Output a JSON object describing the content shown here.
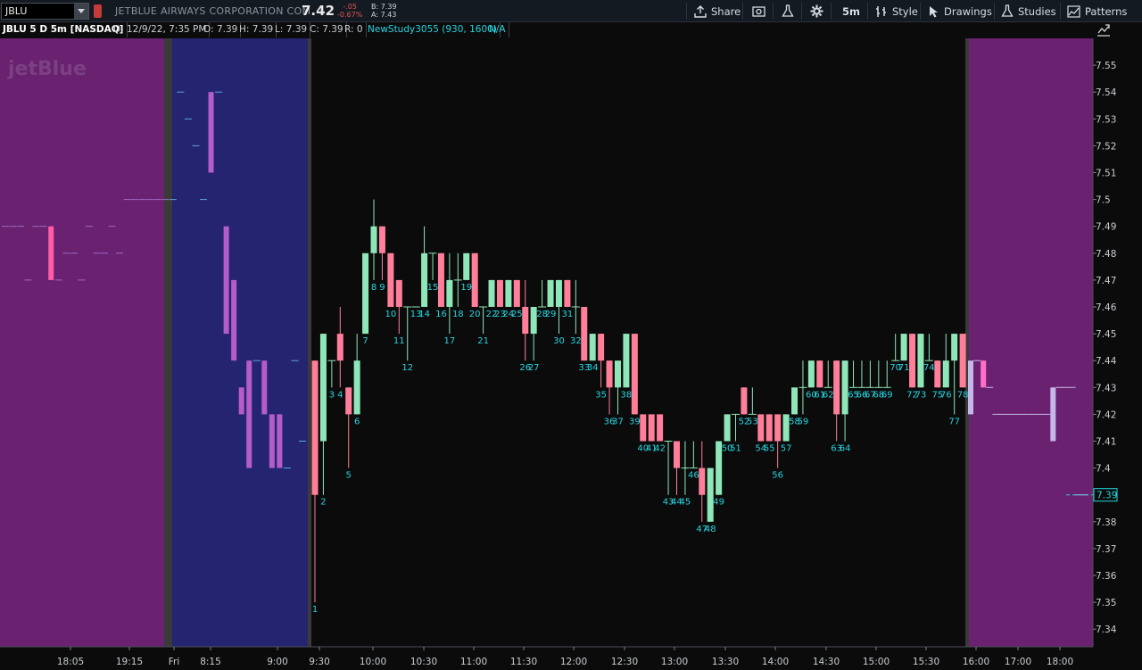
{
  "toolbar": {
    "symbol": "JBLU",
    "company": "JETBLUE AIRWAYS CORPORATION COM",
    "last": "7.42",
    "change": "-.05",
    "change_pct": "-0.67%",
    "bid": "B: 7.39",
    "ask": "A: 7.43",
    "share_label": "Share",
    "interval_label": "5m",
    "style_label": "Style",
    "drawings_label": "Drawings",
    "studies_label": "Studies",
    "patterns_label": "Patterns"
  },
  "infobar": {
    "symbol": "JBLU 5 D 5m [NASDAQ]",
    "date": "D: 12/9/22, 7:35 PM",
    "open": "O: 7.39",
    "high": "H: 7.39",
    "low": "L: 7.39",
    "close": "C: 7.39",
    "range": "R: 0",
    "study": "NewStudy3055 (930, 1600)",
    "study_value": "N/A"
  },
  "watermark": "jetBlue",
  "colors": {
    "up": "#8fe6b8",
    "down": "#ff7f9a",
    "ext_up": "#5aa8d6",
    "ext_down": "#c05cd0",
    "pre_bg": "#252470",
    "after_bg": "#6a2170",
    "session_bg": "#0b0b0b",
    "divider": "#3a3a3a",
    "label": "#25d4e0"
  },
  "chart_data": {
    "type": "candlestick",
    "title": "JBLU 5 D 5m [NASDAQ]",
    "ylim": [
      7.335,
      7.56
    ],
    "y_ticks": [
      "7.55",
      "7.54",
      "7.53",
      "7.52",
      "7.51",
      "7.5",
      "7.49",
      "7.48",
      "7.47",
      "7.46",
      "7.45",
      "7.44",
      "7.43",
      "7.42",
      "7.41",
      "7.4",
      "7.39",
      "7.38",
      "7.37",
      "7.36",
      "7.35",
      "7.34"
    ],
    "x_ticks": [
      "18:05",
      "19:15",
      "Fri",
      "8:15",
      "9:00",
      "9:30",
      "10:00",
      "10:30",
      "11:00",
      "11:30",
      "12:00",
      "12:30",
      "13:00",
      "13:30",
      "14:00",
      "14:30",
      "15:00",
      "15:30",
      "16:00",
      "17:00",
      "18:00"
    ],
    "last_price_label": "7.39",
    "extended_before": [
      {
        "o": 7.49,
        "h": 7.49,
        "l": 7.49,
        "c": 7.49
      },
      {
        "o": 7.49,
        "h": 7.49,
        "l": 7.49,
        "c": 7.49
      },
      {
        "o": 7.49,
        "h": 7.49,
        "l": 7.49,
        "c": 7.49
      },
      {
        "o": 7.47,
        "h": 7.47,
        "l": 7.47,
        "c": 7.47
      },
      {
        "o": 7.49,
        "h": 7.49,
        "l": 7.49,
        "c": 7.49
      },
      {
        "o": 7.49,
        "h": 7.49,
        "l": 7.49,
        "c": 7.49
      },
      {
        "o": 7.49,
        "h": 7.49,
        "l": 7.47,
        "c": 7.47
      },
      {
        "o": 7.47,
        "h": 7.47,
        "l": 7.47,
        "c": 7.47
      },
      {
        "o": 7.48,
        "h": 7.48,
        "l": 7.48,
        "c": 7.48
      },
      {
        "o": 7.48,
        "h": 7.48,
        "l": 7.48,
        "c": 7.48
      },
      {
        "o": 7.47,
        "h": 7.47,
        "l": 7.47,
        "c": 7.47
      },
      {
        "o": 7.49,
        "h": 7.49,
        "l": 7.49,
        "c": 7.49
      },
      {
        "o": 7.48,
        "h": 7.48,
        "l": 7.48,
        "c": 7.48
      },
      {
        "o": 7.48,
        "h": 7.48,
        "l": 7.48,
        "c": 7.48
      },
      {
        "o": 7.49,
        "h": 7.49,
        "l": 7.49,
        "c": 7.49
      },
      {
        "o": 7.48,
        "h": 7.48,
        "l": 7.48,
        "c": 7.48
      },
      {
        "o": 7.5,
        "h": 7.5,
        "l": 7.5,
        "c": 7.5
      },
      {
        "o": 7.5,
        "h": 7.5,
        "l": 7.5,
        "c": 7.5
      },
      {
        "o": 7.5,
        "h": 7.5,
        "l": 7.5,
        "c": 7.5
      },
      {
        "o": 7.5,
        "h": 7.5,
        "l": 7.5,
        "c": 7.5
      },
      {
        "o": 7.5,
        "h": 7.5,
        "l": 7.5,
        "c": 7.5
      },
      {
        "o": 7.5,
        "h": 7.5,
        "l": 7.5,
        "c": 7.5
      },
      {
        "o": 7.5,
        "h": 7.5,
        "l": 7.5,
        "c": 7.5
      },
      {
        "o": 7.54,
        "h": 7.54,
        "l": 7.54,
        "c": 7.54
      },
      {
        "o": 7.53,
        "h": 7.53,
        "l": 7.53,
        "c": 7.53
      },
      {
        "o": 7.52,
        "h": 7.52,
        "l": 7.52,
        "c": 7.52
      },
      {
        "o": 7.5,
        "h": 7.5,
        "l": 7.5,
        "c": 7.5
      },
      {
        "o": 7.54,
        "h": 7.54,
        "l": 7.51,
        "c": 7.51
      },
      {
        "o": 7.54,
        "h": 7.54,
        "l": 7.54,
        "c": 7.54
      },
      {
        "o": 7.49,
        "h": 7.49,
        "l": 7.45,
        "c": 7.45
      },
      {
        "o": 7.47,
        "h": 7.47,
        "l": 7.44,
        "c": 7.44
      },
      {
        "o": 7.43,
        "h": 7.43,
        "l": 7.42,
        "c": 7.42
      },
      {
        "o": 7.44,
        "h": 7.44,
        "l": 7.4,
        "c": 7.4
      },
      {
        "o": 7.44,
        "h": 7.44,
        "l": 7.44,
        "c": 7.44
      },
      {
        "o": 7.44,
        "h": 7.44,
        "l": 7.42,
        "c": 7.42
      },
      {
        "o": 7.42,
        "h": 7.42,
        "l": 7.4,
        "c": 7.4
      },
      {
        "o": 7.42,
        "h": 7.42,
        "l": 7.4,
        "c": 7.4
      },
      {
        "o": 7.4,
        "h": 7.4,
        "l": 7.4,
        "c": 7.4
      },
      {
        "o": 7.44,
        "h": 7.44,
        "l": 7.44,
        "c": 7.44
      },
      {
        "o": 7.41,
        "h": 7.41,
        "l": 7.41,
        "c": 7.41
      }
    ],
    "session": [
      {
        "label": "1",
        "o": 7.44,
        "h": 7.44,
        "l": 7.35,
        "c": 7.39
      },
      {
        "label": "2",
        "o": 7.41,
        "h": 7.45,
        "l": 7.39,
        "c": 7.45
      },
      {
        "label": "3",
        "o": 7.44,
        "h": 7.44,
        "l": 7.43,
        "c": 7.44
      },
      {
        "label": "4",
        "o": 7.45,
        "h": 7.46,
        "l": 7.43,
        "c": 7.44
      },
      {
        "label": "5",
        "o": 7.43,
        "h": 7.43,
        "l": 7.4,
        "c": 7.42
      },
      {
        "label": "6",
        "o": 7.42,
        "h": 7.45,
        "l": 7.42,
        "c": 7.44
      },
      {
        "label": "7",
        "o": 7.45,
        "h": 7.48,
        "l": 7.45,
        "c": 7.48
      },
      {
        "label": "8",
        "o": 7.48,
        "h": 7.5,
        "l": 7.47,
        "c": 7.49
      },
      {
        "label": "9",
        "o": 7.49,
        "h": 7.49,
        "l": 7.47,
        "c": 7.48
      },
      {
        "label": "10",
        "o": 7.48,
        "h": 7.48,
        "l": 7.46,
        "c": 7.46
      },
      {
        "label": "11",
        "o": 7.47,
        "h": 7.47,
        "l": 7.45,
        "c": 7.46
      },
      {
        "label": "12",
        "o": 7.46,
        "h": 7.46,
        "l": 7.44,
        "c": 7.46
      },
      {
        "label": "13",
        "o": 7.46,
        "h": 7.46,
        "l": 7.46,
        "c": 7.46
      },
      {
        "label": "14",
        "o": 7.46,
        "h": 7.49,
        "l": 7.46,
        "c": 7.48
      },
      {
        "label": "15",
        "o": 7.48,
        "h": 7.48,
        "l": 7.47,
        "c": 7.48
      },
      {
        "label": "16",
        "o": 7.48,
        "h": 7.48,
        "l": 7.46,
        "c": 7.46
      },
      {
        "label": "17",
        "o": 7.46,
        "h": 7.48,
        "l": 7.45,
        "c": 7.47
      },
      {
        "label": "18",
        "o": 7.47,
        "h": 7.48,
        "l": 7.46,
        "c": 7.47
      },
      {
        "label": "19",
        "o": 7.47,
        "h": 7.48,
        "l": 7.47,
        "c": 7.48
      },
      {
        "label": "20",
        "o": 7.48,
        "h": 7.48,
        "l": 7.46,
        "c": 7.46
      },
      {
        "label": "21",
        "o": 7.46,
        "h": 7.46,
        "l": 7.45,
        "c": 7.46
      },
      {
        "label": "22",
        "o": 7.46,
        "h": 7.47,
        "l": 7.46,
        "c": 7.47
      },
      {
        "label": "23",
        "o": 7.47,
        "h": 7.47,
        "l": 7.46,
        "c": 7.46
      },
      {
        "label": "24",
        "o": 7.46,
        "h": 7.47,
        "l": 7.46,
        "c": 7.47
      },
      {
        "label": "25",
        "o": 7.47,
        "h": 7.47,
        "l": 7.46,
        "c": 7.46
      },
      {
        "label": "26",
        "o": 7.46,
        "h": 7.47,
        "l": 7.44,
        "c": 7.45
      },
      {
        "label": "27",
        "o": 7.45,
        "h": 7.46,
        "l": 7.44,
        "c": 7.46
      },
      {
        "label": "28",
        "o": 7.46,
        "h": 7.47,
        "l": 7.46,
        "c": 7.46
      },
      {
        "label": "29",
        "o": 7.46,
        "h": 7.47,
        "l": 7.46,
        "c": 7.47
      },
      {
        "label": "30",
        "o": 7.46,
        "h": 7.47,
        "l": 7.45,
        "c": 7.47
      },
      {
        "label": "31",
        "o": 7.47,
        "h": 7.47,
        "l": 7.46,
        "c": 7.46
      },
      {
        "label": "32",
        "o": 7.46,
        "h": 7.47,
        "l": 7.45,
        "c": 7.46
      },
      {
        "label": "33",
        "o": 7.46,
        "h": 7.46,
        "l": 7.44,
        "c": 7.44
      },
      {
        "label": "34",
        "o": 7.44,
        "h": 7.45,
        "l": 7.44,
        "c": 7.45
      },
      {
        "label": "35",
        "o": 7.45,
        "h": 7.45,
        "l": 7.43,
        "c": 7.44
      },
      {
        "label": "36",
        "o": 7.44,
        "h": 7.44,
        "l": 7.42,
        "c": 7.43
      },
      {
        "label": "37",
        "o": 7.43,
        "h": 7.44,
        "l": 7.42,
        "c": 7.44
      },
      {
        "label": "38",
        "o": 7.43,
        "h": 7.45,
        "l": 7.43,
        "c": 7.45
      },
      {
        "label": "39",
        "o": 7.45,
        "h": 7.45,
        "l": 7.42,
        "c": 7.42
      },
      {
        "label": "40",
        "o": 7.42,
        "h": 7.42,
        "l": 7.41,
        "c": 7.41
      },
      {
        "label": "41",
        "o": 7.42,
        "h": 7.42,
        "l": 7.41,
        "c": 7.41
      },
      {
        "label": "42",
        "o": 7.42,
        "h": 7.42,
        "l": 7.41,
        "c": 7.41
      },
      {
        "label": "43",
        "o": 7.41,
        "h": 7.41,
        "l": 7.39,
        "c": 7.41
      },
      {
        "label": "44",
        "o": 7.41,
        "h": 7.41,
        "l": 7.39,
        "c": 7.4
      },
      {
        "label": "45",
        "o": 7.4,
        "h": 7.41,
        "l": 7.39,
        "c": 7.4
      },
      {
        "label": "46",
        "o": 7.4,
        "h": 7.41,
        "l": 7.4,
        "c": 7.4
      },
      {
        "label": "47",
        "o": 7.4,
        "h": 7.41,
        "l": 7.38,
        "c": 7.39
      },
      {
        "label": "48",
        "o": 7.38,
        "h": 7.4,
        "l": 7.38,
        "c": 7.4
      },
      {
        "label": "49",
        "o": 7.39,
        "h": 7.41,
        "l": 7.39,
        "c": 7.41
      },
      {
        "label": "50",
        "o": 7.41,
        "h": 7.42,
        "l": 7.41,
        "c": 7.42
      },
      {
        "label": "51",
        "o": 7.42,
        "h": 7.42,
        "l": 7.41,
        "c": 7.42
      },
      {
        "label": "52",
        "o": 7.43,
        "h": 7.43,
        "l": 7.42,
        "c": 7.42
      },
      {
        "label": "53",
        "o": 7.42,
        "h": 7.43,
        "l": 7.42,
        "c": 7.42
      },
      {
        "label": "54",
        "o": 7.42,
        "h": 7.42,
        "l": 7.41,
        "c": 7.41
      },
      {
        "label": "55",
        "o": 7.42,
        "h": 7.42,
        "l": 7.41,
        "c": 7.41
      },
      {
        "label": "56",
        "o": 7.42,
        "h": 7.42,
        "l": 7.4,
        "c": 7.41
      },
      {
        "label": "57",
        "o": 7.41,
        "h": 7.42,
        "l": 7.41,
        "c": 7.42
      },
      {
        "label": "58",
        "o": 7.42,
        "h": 7.43,
        "l": 7.42,
        "c": 7.43
      },
      {
        "label": "59",
        "o": 7.43,
        "h": 7.44,
        "l": 7.42,
        "c": 7.43
      },
      {
        "label": "60",
        "o": 7.43,
        "h": 7.44,
        "l": 7.43,
        "c": 7.44
      },
      {
        "label": "61",
        "o": 7.44,
        "h": 7.44,
        "l": 7.43,
        "c": 7.43
      },
      {
        "label": "62",
        "o": 7.43,
        "h": 7.44,
        "l": 7.43,
        "c": 7.43
      },
      {
        "label": "63",
        "o": 7.44,
        "h": 7.44,
        "l": 7.41,
        "c": 7.42
      },
      {
        "label": "64",
        "o": 7.42,
        "h": 7.44,
        "l": 7.41,
        "c": 7.44
      },
      {
        "label": "65",
        "o": 7.43,
        "h": 7.44,
        "l": 7.43,
        "c": 7.43
      },
      {
        "label": "66",
        "o": 7.43,
        "h": 7.44,
        "l": 7.43,
        "c": 7.43
      },
      {
        "label": "67",
        "o": 7.43,
        "h": 7.44,
        "l": 7.43,
        "c": 7.43
      },
      {
        "label": "68",
        "o": 7.43,
        "h": 7.44,
        "l": 7.43,
        "c": 7.43
      },
      {
        "label": "69",
        "o": 7.43,
        "h": 7.44,
        "l": 7.43,
        "c": 7.43
      },
      {
        "label": "70",
        "o": 7.44,
        "h": 7.45,
        "l": 7.44,
        "c": 7.44
      },
      {
        "label": "71",
        "o": 7.44,
        "h": 7.45,
        "l": 7.44,
        "c": 7.45
      },
      {
        "label": "72",
        "o": 7.45,
        "h": 7.45,
        "l": 7.43,
        "c": 7.43
      },
      {
        "label": "73",
        "o": 7.43,
        "h": 7.45,
        "l": 7.43,
        "c": 7.45
      },
      {
        "label": "74",
        "o": 7.44,
        "h": 7.45,
        "l": 7.44,
        "c": 7.44
      },
      {
        "label": "75",
        "o": 7.44,
        "h": 7.44,
        "l": 7.43,
        "c": 7.43
      },
      {
        "label": "76",
        "o": 7.43,
        "h": 7.45,
        "l": 7.43,
        "c": 7.44
      },
      {
        "label": "77",
        "o": 7.44,
        "h": 7.45,
        "l": 7.42,
        "c": 7.45
      },
      {
        "label": "78",
        "o": 7.45,
        "h": 7.45,
        "l": 7.43,
        "c": 7.43
      }
    ],
    "extended_after": [
      {
        "o": 7.42,
        "h": 7.44,
        "l": 7.42,
        "c": 7.44
      },
      {
        "o": 7.44,
        "h": 7.44,
        "l": 7.44,
        "c": 7.44
      },
      {
        "o": 7.44,
        "h": 7.44,
        "l": 7.43,
        "c": 7.43
      },
      {
        "o": 7.43,
        "h": 7.43,
        "l": 7.43,
        "c": 7.43
      },
      {
        "o": 7.42,
        "h": 7.42,
        "l": 7.42,
        "c": 7.42
      },
      {
        "o": 7.42,
        "h": 7.42,
        "l": 7.42,
        "c": 7.42
      },
      {
        "o": 7.42,
        "h": 7.42,
        "l": 7.42,
        "c": 7.42
      },
      {
        "o": 7.42,
        "h": 7.42,
        "l": 7.42,
        "c": 7.42
      },
      {
        "o": 7.42,
        "h": 7.42,
        "l": 7.42,
        "c": 7.42
      },
      {
        "o": 7.42,
        "h": 7.42,
        "l": 7.42,
        "c": 7.42
      },
      {
        "o": 7.42,
        "h": 7.42,
        "l": 7.42,
        "c": 7.42
      },
      {
        "o": 7.42,
        "h": 7.42,
        "l": 7.42,
        "c": 7.42
      },
      {
        "o": 7.42,
        "h": 7.42,
        "l": 7.42,
        "c": 7.42
      },
      {
        "o": 7.41,
        "h": 7.43,
        "l": 7.41,
        "c": 7.43
      },
      {
        "o": 7.43,
        "h": 7.43,
        "l": 7.43,
        "c": 7.43
      },
      {
        "o": 7.43,
        "h": 7.43,
        "l": 7.43,
        "c": 7.43
      },
      {
        "o": 7.43,
        "h": 7.43,
        "l": 7.43,
        "c": 7.43
      },
      {
        "o": 7.39,
        "h": 7.39,
        "l": 7.39,
        "c": 7.39
      },
      {
        "o": 7.39,
        "h": 7.39,
        "l": 7.39,
        "c": 7.39
      }
    ]
  }
}
